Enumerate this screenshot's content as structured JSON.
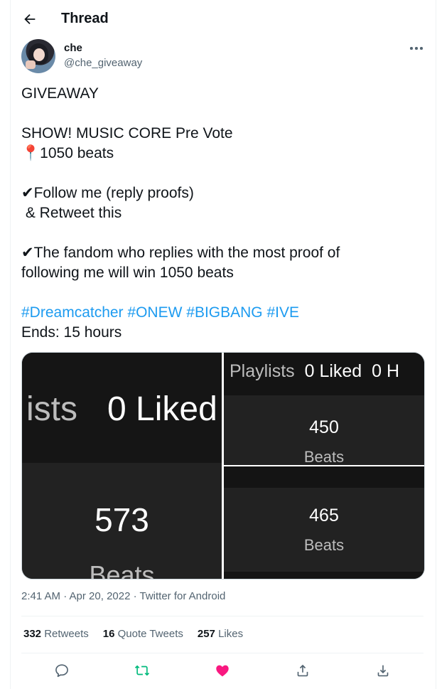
{
  "header": {
    "title": "Thread"
  },
  "author": {
    "name": "che",
    "handle": "@che_giveaway"
  },
  "tweet": {
    "line1": "GIVEAWAY",
    "line2": "SHOW! MUSIC CORE  Pre Vote",
    "pin_emoji": "📍",
    "line3": "1050 beats",
    "check": "✔",
    "line4": "Follow me (reply proofs)",
    "line5": " & Retweet this",
    "line6a": "The fandom who replies with the most proof of",
    "line6b": "following me will win 1050 beats",
    "hashtags": [
      "#Dreamcatcher",
      "#ONEW",
      "#BIGBANG",
      "#IVE"
    ],
    "ends": "Ends: 15 hours"
  },
  "media": {
    "p1": {
      "top_a": "ists",
      "top_b": "0 Liked",
      "value": "573",
      "label": "Beats"
    },
    "p2": {
      "top_a": "Playlists",
      "top_b": "0 Liked",
      "top_c": "0 H",
      "value": "450",
      "label": "Beats"
    },
    "p3": {
      "value": "465",
      "label": "Beats"
    }
  },
  "meta": {
    "timestamp": "2:41 AM · Apr 20, 2022 · Twitter for Android"
  },
  "stats": {
    "retweets_count": "332",
    "retweets_label": "Retweets",
    "quotes_count": "16",
    "quotes_label": "Quote Tweets",
    "likes_count": "257",
    "likes_label": "Likes"
  },
  "colors": {
    "accent": "#1d9bf0",
    "like": "#f91880",
    "retweet": "#00ba7c"
  }
}
